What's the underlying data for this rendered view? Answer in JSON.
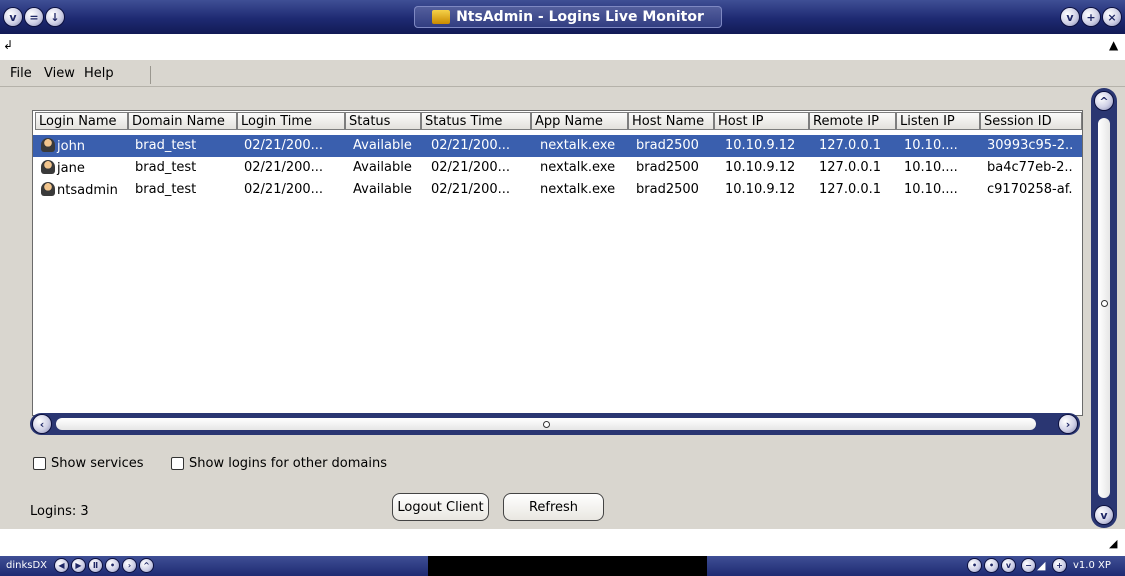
{
  "window": {
    "title": "NtsAdmin - Logins Live Monitor"
  },
  "menu": {
    "items": [
      "File",
      "View",
      "Help"
    ]
  },
  "table": {
    "columns": [
      "Login Name",
      "Domain Name",
      "Login Time",
      "Status",
      "Status Time",
      "App Name",
      "Host Name",
      "Host IP",
      "Remote IP",
      "Listen IP",
      "Session ID"
    ],
    "rows": [
      [
        "john",
        "brad_test",
        "02/21/200...",
        "Available",
        "02/21/200...",
        "nextalk.exe",
        "brad2500",
        "10.10.9.12",
        "127.0.0.1",
        "10.10....",
        "30993c95-2.."
      ],
      [
        "jane",
        "brad_test",
        "02/21/200...",
        "Available",
        "02/21/200...",
        "nextalk.exe",
        "brad2500",
        "10.10.9.12",
        "127.0.0.1",
        "10.10....",
        "ba4c77eb-2.."
      ],
      [
        "ntsadmin",
        "brad_test",
        "02/21/200...",
        "Available",
        "02/21/200...",
        "nextalk.exe",
        "brad2500",
        "10.10.9.12",
        "127.0.0.1",
        "10.10....",
        "c9170258-af."
      ]
    ],
    "selected_row": 0
  },
  "options": {
    "show_services": "Show services",
    "show_other_domains": "Show logins for other domains"
  },
  "status": {
    "logins": "Logins: 3"
  },
  "buttons": {
    "logout": "Logout Client",
    "refresh": "Refresh"
  },
  "taskbar": {
    "left_label": "dinksDX",
    "right_label": "v1.0 XP"
  },
  "colors": {
    "titlebar": "#1e2a72",
    "selection": "#3a5fae",
    "scrollbar": "#2a3672"
  }
}
